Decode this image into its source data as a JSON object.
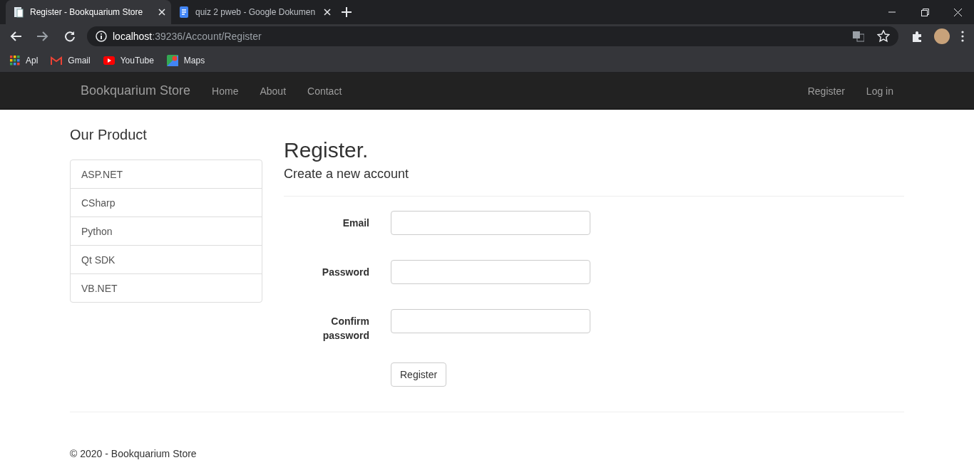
{
  "browser": {
    "tabs": [
      {
        "title": "Register - Bookquarium Store",
        "kind": "page",
        "selected": true
      },
      {
        "title": "quiz 2 pweb - Google Dokumen",
        "kind": "doc",
        "selected": false
      }
    ],
    "address": {
      "host": "localhost",
      "path": ":39236/Account/Register"
    },
    "bookmarks": [
      {
        "label": "Apl",
        "kind": "apps"
      },
      {
        "label": "Gmail",
        "kind": "mail"
      },
      {
        "label": "YouTube",
        "kind": "video"
      },
      {
        "label": "Maps",
        "kind": "maps"
      }
    ]
  },
  "navbar": {
    "brand": "Bookquarium Store",
    "links": [
      "Home",
      "About",
      "Contact"
    ],
    "right_links": [
      "Register",
      "Log in"
    ]
  },
  "sidebar": {
    "title": "Our Product",
    "items": [
      "ASP.NET",
      "CSharp",
      "Python",
      "Qt SDK",
      "VB.NET"
    ]
  },
  "main": {
    "title": "Register.",
    "subtitle": "Create a new account",
    "fields": [
      "Email",
      "Password",
      "Confirm password"
    ],
    "button": "Register"
  },
  "footer": "© 2020 - Bookquarium Store"
}
